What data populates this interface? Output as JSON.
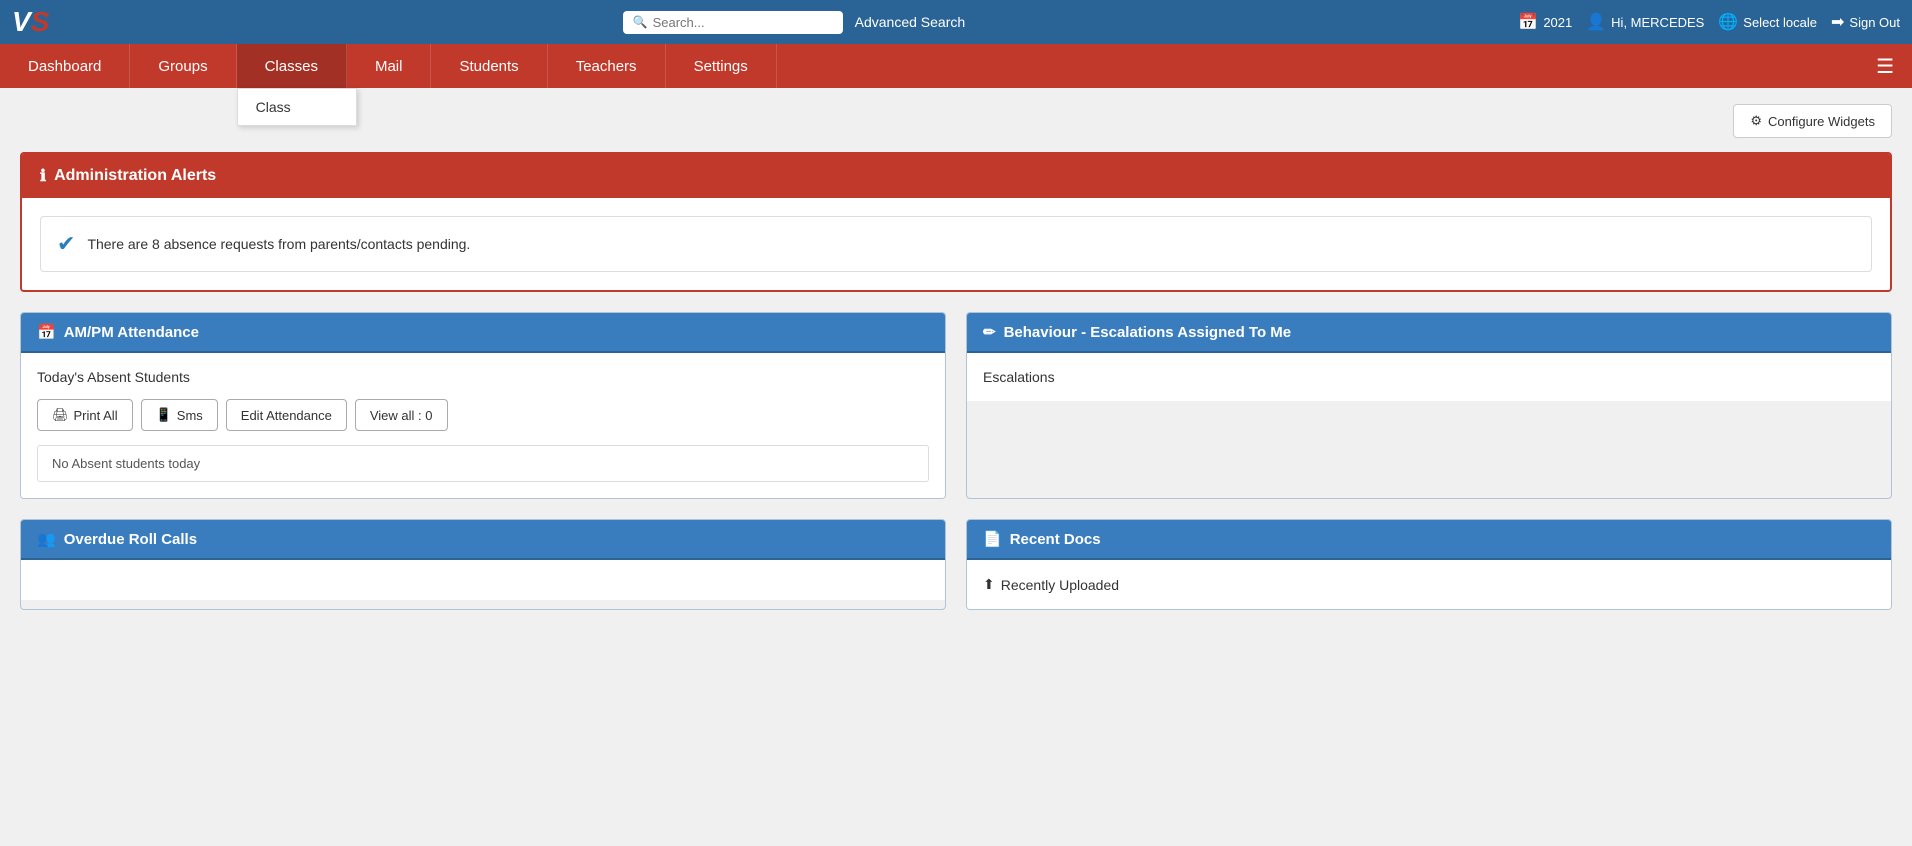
{
  "logo": {
    "v": "V",
    "s": "S"
  },
  "topbar": {
    "search_placeholder": "Search...",
    "advanced_search_label": "Advanced Search",
    "year": "2021",
    "user_greeting": "Hi, MERCEDES",
    "select_locale_label": "Select locale",
    "sign_out_label": "Sign Out"
  },
  "nav": {
    "items": [
      {
        "id": "dashboard",
        "label": "Dashboard"
      },
      {
        "id": "groups",
        "label": "Groups"
      },
      {
        "id": "classes",
        "label": "Classes"
      },
      {
        "id": "mail",
        "label": "Mail"
      },
      {
        "id": "students",
        "label": "Students"
      },
      {
        "id": "teachers",
        "label": "Teachers"
      },
      {
        "id": "settings",
        "label": "Settings"
      }
    ],
    "classes_dropdown": [
      {
        "label": "Class"
      }
    ]
  },
  "toolbar": {
    "configure_widgets_label": "Configure Widgets",
    "configure_icon": "⚙"
  },
  "admin_alerts": {
    "header_icon": "ℹ",
    "header_label": "Administration Alerts",
    "alert_icon": "✔",
    "alert_text": "There are 8 absence requests from parents/contacts pending."
  },
  "attendance_widget": {
    "icon": "📅",
    "title": "AM/PM Attendance",
    "absent_title": "Today's Absent Students",
    "print_icon": "🖨",
    "print_label": "Print All",
    "sms_icon": "📱",
    "sms_label": "Sms",
    "edit_label": "Edit Attendance",
    "view_all_label": "View all : 0",
    "no_absent_label": "No Absent students today"
  },
  "behaviour_widget": {
    "icon": "✏",
    "title": "Behaviour - Escalations Assigned To Me",
    "escalations_label": "Escalations"
  },
  "recent_docs_widget": {
    "icon": "📄",
    "title": "Recent Docs",
    "uploaded_icon": "⬆",
    "uploaded_label": "Recently Uploaded"
  },
  "overdue_widget": {
    "icon": "👥",
    "title": "Overdue Roll Calls"
  }
}
